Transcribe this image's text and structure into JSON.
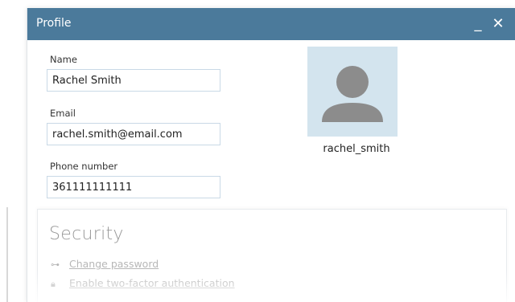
{
  "window": {
    "title": "Profile",
    "minimize_glyph": "_",
    "close_glyph": "✕",
    "titlebar_color": "#4b7a9b"
  },
  "form": {
    "name_label": "Name",
    "name_value": "Rachel Smith",
    "email_label": "Email",
    "email_value": "rachel.smith@email.com",
    "phone_label": "Phone number",
    "phone_value": "361111111111"
  },
  "profile": {
    "username": "rachel_smith",
    "avatar_icon": "user-silhouette-icon",
    "avatar_bg_color": "#d3e4ee"
  },
  "security": {
    "title": "Security",
    "change_password_label": "Change password",
    "change_password_icon": "key-icon",
    "two_factor_label": "Enable two-factor authentication",
    "two_factor_icon": "lock-icon"
  }
}
